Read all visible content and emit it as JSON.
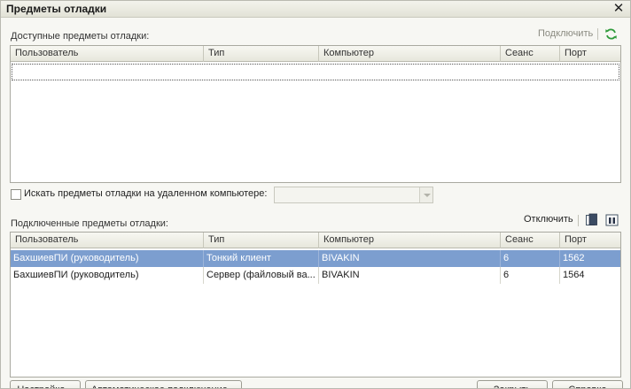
{
  "window": {
    "title": "Предметы отладки",
    "close_icon": "close-icon"
  },
  "available": {
    "label": "Доступные предметы отладки:",
    "connect_label": "Подключить",
    "refresh_icon": "refresh-icon",
    "columns": [
      "Пользователь",
      "Тип",
      "Компьютер",
      "Сеанс",
      "Порт"
    ],
    "rows": []
  },
  "remote": {
    "checkbox_label": "Искать предметы отладки на удаленном компьютере:",
    "checked": false,
    "computer_value": ""
  },
  "connected": {
    "label": "Подключенные предметы отладки:",
    "disconnect_label": "Отключить",
    "toolbar_icons": [
      "copy-icon",
      "pause-icon"
    ],
    "columns": [
      "Пользователь",
      "Тип",
      "Компьютер",
      "Сеанс",
      "Порт"
    ],
    "rows": [
      {
        "user": "БахшиевПИ (руководитель)",
        "type": "Тонкий клиент",
        "computer": "BIVAKIN",
        "session": "6",
        "port": "1562",
        "selected": true
      },
      {
        "user": "БахшиевПИ (руководитель)",
        "type": "Сервер (файловый ва...",
        "computer": "BIVAKIN",
        "session": "6",
        "port": "1564",
        "selected": false
      }
    ]
  },
  "footer": {
    "settings_label": "Настройка...",
    "auto_connect_label": "Автоматическое подключение...",
    "close_label": "Закрыть",
    "help_label": "Справка"
  },
  "colors": {
    "selection": "#7c9ecf",
    "refresh": "#2e9a3a"
  }
}
